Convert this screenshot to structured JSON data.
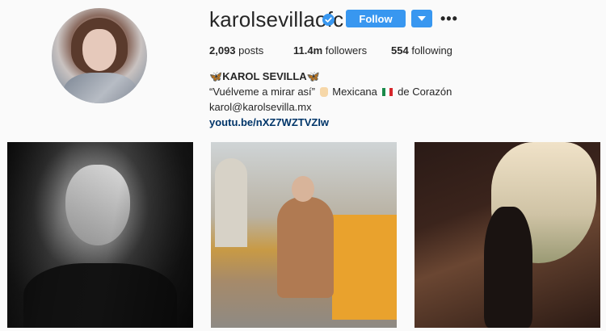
{
  "profile": {
    "username": "karolsevillaofc",
    "follow_label": "Follow",
    "more_label": "•••",
    "stats": {
      "posts_value": "2,093",
      "posts_label": "posts",
      "followers_value": "11.4m",
      "followers_label": "followers",
      "following_value": "554",
      "following_label": "following"
    },
    "bio": {
      "name_prefix": "🦋",
      "name": "KAROL SEVILLA",
      "name_suffix": "🦋",
      "line_quote": "“Vuélveme a mirar así”",
      "line_mexicana": "Mexicana",
      "line_rest": "de Corazón",
      "email": "karol@karolsevilla.mx",
      "link": "youtu.be/nXZ7WZTVZIw"
    }
  },
  "colors": {
    "accent": "#3897f0",
    "link": "#003569",
    "text": "#262626",
    "background": "#fafafa"
  },
  "icons": {
    "verified": "verified-badge-icon",
    "dropdown": "chevron-down-icon",
    "more": "more-options-icon"
  }
}
